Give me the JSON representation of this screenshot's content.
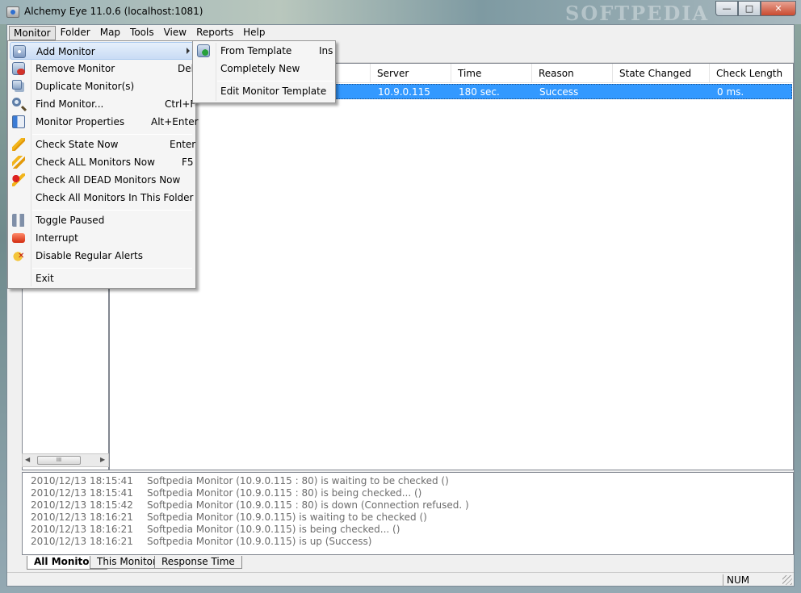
{
  "window": {
    "title": "Alchemy Eye 11.0.6 (localhost:1081)",
    "watermark": "SOFTPEDIA",
    "buttons": {
      "minimize": "—",
      "maximize": "□",
      "close": "✕"
    }
  },
  "menubar": [
    "Monitor",
    "Folder",
    "Map",
    "Tools",
    "View",
    "Reports",
    "Help"
  ],
  "monitor_menu": {
    "items": [
      {
        "label": "Add Monitor",
        "shortcut": "",
        "icon": "add-monitor-icon",
        "highlighted": true,
        "submenu": true
      },
      {
        "label": "Remove Monitor",
        "shortcut": "Del",
        "icon": "remove-monitor-icon"
      },
      {
        "label": "Duplicate Monitor(s)",
        "shortcut": "",
        "icon": "duplicate-monitor-icon"
      },
      {
        "label": "Find Monitor...",
        "shortcut": "Ctrl+F",
        "icon": "find-monitor-icon"
      },
      {
        "label": "Monitor Properties",
        "shortcut": "Alt+Enter",
        "icon": "properties-icon"
      },
      {
        "label": "Check State Now",
        "shortcut": "Enter",
        "icon": "lightning-icon"
      },
      {
        "label": "Check ALL Monitors Now",
        "shortcut": "F5",
        "icon": "double-lightning-icon"
      },
      {
        "label": "Check All DEAD Monitors Now",
        "shortcut": "",
        "icon": "dead-lightning-icon"
      },
      {
        "label": "Check All Monitors In This Folder",
        "shortcut": ""
      },
      {
        "label": "Toggle Paused",
        "shortcut": "",
        "icon": "pause-icon"
      },
      {
        "label": "Interrupt",
        "shortcut": "",
        "icon": "interrupt-icon"
      },
      {
        "label": "Disable Regular Alerts",
        "shortcut": "",
        "icon": "disable-alerts-icon"
      },
      {
        "label": "Exit",
        "shortcut": ""
      }
    ]
  },
  "add_submenu": {
    "items": [
      {
        "label": "From Template",
        "shortcut": "Ins",
        "icon": "template-add-icon"
      },
      {
        "label": "Completely New",
        "shortcut": ""
      },
      {
        "label": "Edit Monitor Template",
        "shortcut": ""
      }
    ]
  },
  "list": {
    "columns": [
      "Server",
      "Time",
      "Reason",
      "State Changed",
      "Check Length"
    ],
    "selected_row": {
      "server": "10.9.0.115",
      "time": "180 sec.",
      "reason": "Success",
      "state_changed": "",
      "check_length": "0 ms."
    }
  },
  "scrollbar": {
    "thumb_glyph": "III",
    "left_arrow": "◀",
    "right_arrow": "▶"
  },
  "log": [
    {
      "ts": "2010/12/13 18:15:41",
      "msg": "Softpedia Monitor (10.9.0.115 : 80) is waiting to be checked ()"
    },
    {
      "ts": "2010/12/13 18:15:41",
      "msg": "Softpedia Monitor (10.9.0.115 : 80) is being checked... ()"
    },
    {
      "ts": "2010/12/13 18:15:42",
      "msg": "Softpedia Monitor (10.9.0.115 : 80) is down (Connection refused. )"
    },
    {
      "ts": "2010/12/13 18:16:21",
      "msg": "Softpedia Monitor (10.9.0.115) is waiting to be checked ()"
    },
    {
      "ts": "2010/12/13 18:16:21",
      "msg": "Softpedia Monitor (10.9.0.115) is being checked... ()"
    },
    {
      "ts": "2010/12/13 18:16:21",
      "msg": "Softpedia Monitor (10.9.0.115) is up (Success)"
    }
  ],
  "tabs": [
    "All Monitors",
    "This Monitor",
    "Response Time"
  ],
  "status": {
    "num": "NUM"
  }
}
